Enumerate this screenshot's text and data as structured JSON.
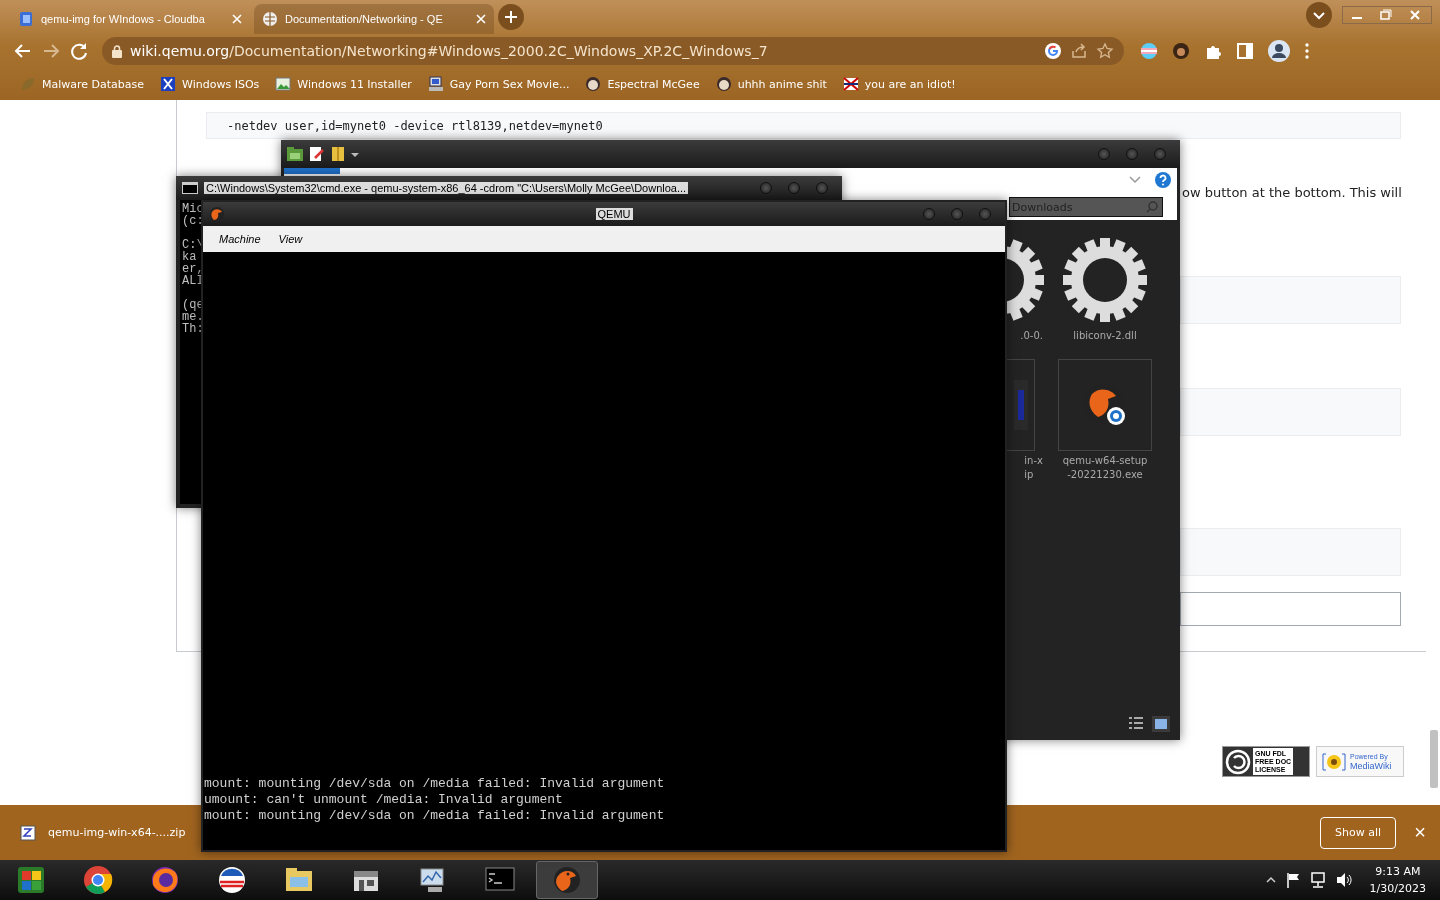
{
  "browser": {
    "tabs": [
      {
        "title": "qemu-img for WIndows - Cloudba",
        "selected": false
      },
      {
        "title": "Documentation/Networking - QE",
        "selected": true
      }
    ],
    "url_host": "wiki.qemu.org",
    "url_path": "/Documentation/Networking#Windows_2000.2C_Windows_XP.2C_Windows_7",
    "bookmarks": [
      {
        "label": "Malware Database",
        "kind": "leaf"
      },
      {
        "label": "Windows ISOs",
        "kind": "x"
      },
      {
        "label": "Windows 11 Installer",
        "kind": "image"
      },
      {
        "label": "Gay Porn Sex Movie...",
        "kind": "computer"
      },
      {
        "label": "Espectral McGee",
        "kind": "face"
      },
      {
        "label": "uhhh anime shit",
        "kind": "face"
      },
      {
        "label": "you are an idiot!",
        "kind": "flag"
      }
    ]
  },
  "page": {
    "code": "-netdev user,id=mynet0 -device rtl8139,netdev=mynet0",
    "paragraph": "ow button at the bottom. This will",
    "license_badge": [
      "GNU FDL",
      "FREE DOC",
      "LICENSE"
    ],
    "powered_badge": [
      "Powered By",
      "MediaWiki"
    ]
  },
  "explorer": {
    "search": "Downloads",
    "files": [
      {
        "name": ".0-0.",
        "kind": "gear"
      },
      {
        "name": "libiconv-2.dll",
        "kind": "gear"
      },
      {
        "name": "in-x\nip",
        "kind": "archive"
      },
      {
        "name": "qemu-w64-setup\n-20221230.exe",
        "kind": "installer"
      }
    ]
  },
  "cmd": {
    "title": "C:\\Windows\\System32\\cmd.exe - qemu-system-x86_64  -cdrom \"C:\\Users\\Molly McGee\\Downloa...",
    "blocks": [
      [
        "Mic",
        "(c:"
      ],
      [
        "C:\\",
        "ka",
        "er,",
        "ALI"
      ],
      [
        "(qe",
        "me.",
        "Th:"
      ]
    ]
  },
  "qemu": {
    "title": "QEMU",
    "menu": [
      "Machine",
      "View"
    ],
    "console": [
      "mount: mounting /dev/sda on /media failed: Invalid argument",
      "umount: can't unmount /media: Invalid argument",
      "mount: mounting /dev/sda on /media failed: Invalid argument"
    ]
  },
  "download_bar": {
    "file": "qemu-img-win-x64-....zip",
    "show_all": "Show all",
    "close": "×"
  },
  "taskbar": {
    "apps": [
      {
        "kind": "tiles",
        "selected": false
      },
      {
        "kind": "chrome",
        "selected": false
      },
      {
        "kind": "firefox",
        "selected": false
      },
      {
        "kind": "roundel",
        "selected": false
      },
      {
        "kind": "folder",
        "selected": false
      },
      {
        "kind": "store",
        "selected": false
      },
      {
        "kind": "monitor",
        "selected": false
      },
      {
        "kind": "terminal",
        "selected": false
      },
      {
        "kind": "qemu",
        "selected": true
      }
    ],
    "time": "9:13 AM",
    "date": "1/30/2023"
  }
}
